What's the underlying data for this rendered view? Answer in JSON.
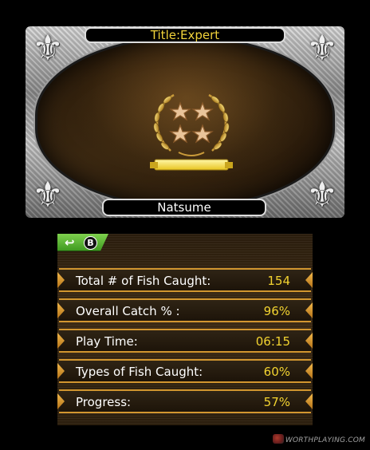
{
  "profile": {
    "title_text": "Title:Expert",
    "player_name": "Natsume",
    "rank_stars": 4
  },
  "bottom": {
    "back_button": {
      "arrow_icon": "return-arrow-icon",
      "button_glyph": "B"
    },
    "stats": [
      {
        "label": "Total # of Fish Caught:",
        "value": "154"
      },
      {
        "label": "Overall Catch % :",
        "value": "96%"
      },
      {
        "label": "Play Time:",
        "value": "06:15"
      },
      {
        "label": "Types of Fish Caught:",
        "value": "60%"
      },
      {
        "label": "Progress:",
        "value": "57%"
      }
    ]
  },
  "watermark": {
    "text": "WORTHPLAYING.COM"
  },
  "colors": {
    "title_text": "#f1d23a",
    "stat_value": "#f2d330",
    "row_border": "#d2962f",
    "back_button": "#5bb836"
  }
}
